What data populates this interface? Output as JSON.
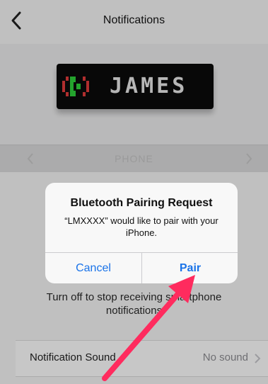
{
  "nav": {
    "title": "Notifications",
    "back_icon": "chevron-left-icon"
  },
  "device": {
    "display_text": "JAMES",
    "icon": "phone-ringing-icon",
    "colors": {
      "green": "#2fd13a",
      "red": "#e23b3b",
      "led": "#e9e9e9"
    }
  },
  "picker": {
    "label": "PHONE"
  },
  "alert": {
    "title": "Bluetooth Pairing Request",
    "message": "“LMXXXX” would like to pair with your iPhone.",
    "cancel_label": "Cancel",
    "pair_label": "Pair"
  },
  "description": {
    "text": "Turn off to stop receiving smartphone notifications"
  },
  "sound_row": {
    "label": "Notification Sound",
    "value": "No sound"
  },
  "annotation": {
    "arrow_color": "#ff2b5e"
  },
  "colors": {
    "accent": "#1a73e8",
    "arrow": "#ff2b5e"
  }
}
